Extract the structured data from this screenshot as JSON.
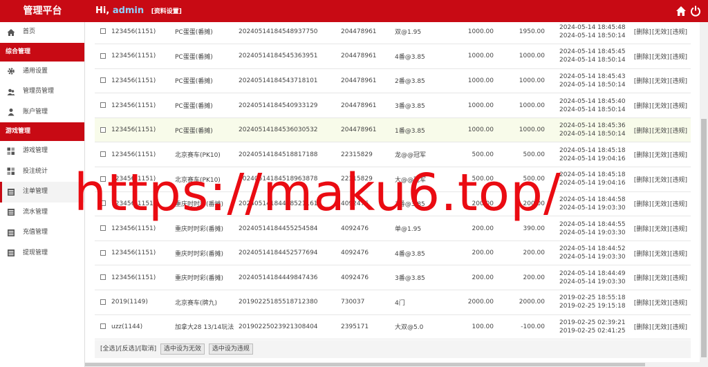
{
  "header": {
    "brand": "管理平台",
    "greeting": "Hi,",
    "username": "admin",
    "profile_link": "[资料设置]",
    "icons": [
      "home-icon",
      "power-icon"
    ]
  },
  "sidebar": {
    "home": "首页",
    "section1": "综合管理",
    "general_settings": "通用设置",
    "admin_mgmt": "管理员管理",
    "account_mgmt": "账户管理",
    "section2": "游戏管理",
    "game_mgmt": "游戏管理",
    "bet_stats": "投注统计",
    "order_mgmt": "注单管理",
    "flow_mgmt": "流水管理",
    "recharge_mgmt": "充值管理",
    "withdraw_mgmt": "提现管理"
  },
  "rows": [
    {
      "user": "123456(1151)",
      "game": "PC蛋蛋(番摊)",
      "order": "20240514184548937750",
      "period": "204478961",
      "bet": "双@1.95",
      "amount": "1000.00",
      "payout": "1950.00",
      "t1": "2024-05-14 18:45:48",
      "t2": "2024-05-14 18:50:14",
      "highlight": false
    },
    {
      "user": "123456(1151)",
      "game": "PC蛋蛋(番摊)",
      "order": "20240514184545363951",
      "period": "204478961",
      "bet": "4番@3.85",
      "amount": "1000.00",
      "payout": "1000.00",
      "t1": "2024-05-14 18:45:45",
      "t2": "2024-05-14 18:50:14",
      "highlight": false
    },
    {
      "user": "123456(1151)",
      "game": "PC蛋蛋(番摊)",
      "order": "20240514184543718101",
      "period": "204478961",
      "bet": "2番@3.85",
      "amount": "1000.00",
      "payout": "1000.00",
      "t1": "2024-05-14 18:45:43",
      "t2": "2024-05-14 18:50:14",
      "highlight": false
    },
    {
      "user": "123456(1151)",
      "game": "PC蛋蛋(番摊)",
      "order": "20240514184540933129",
      "period": "204478961",
      "bet": "3番@3.85",
      "amount": "1000.00",
      "payout": "1000.00",
      "t1": "2024-05-14 18:45:40",
      "t2": "2024-05-14 18:50:14",
      "highlight": false
    },
    {
      "user": "123456(1151)",
      "game": "PC蛋蛋(番摊)",
      "order": "20240514184536030532",
      "period": "204478961",
      "bet": "1番@3.85",
      "amount": "1000.00",
      "payout": "1000.00",
      "t1": "2024-05-14 18:45:36",
      "t2": "2024-05-14 18:50:14",
      "highlight": true
    },
    {
      "user": "123456(1151)",
      "game": "北京赛车(PK10)",
      "order": "20240514184518817188",
      "period": "22315829",
      "bet": "龙@@冠军",
      "amount": "500.00",
      "payout": "500.00",
      "t1": "2024-05-14 18:45:18",
      "t2": "2024-05-14 19:04:16",
      "highlight": false
    },
    {
      "user": "123456(1151)",
      "game": "北京赛车(PK10)",
      "order": "20240514184518963878",
      "period": "22315829",
      "bet": "大@@冠军",
      "amount": "500.00",
      "payout": "500.00",
      "t1": "2024-05-14 18:45:18",
      "t2": "2024-05-14 19:04:16",
      "highlight": false
    },
    {
      "user": "123456(1151)",
      "game": "重庆时时彩(番摊)",
      "order": "20240514184458521161",
      "period": "4092476",
      "bet": "3番@3.85",
      "amount": "200.00",
      "payout": "200.00",
      "t1": "2024-05-14 18:44:58",
      "t2": "2024-05-14 19:03:30",
      "highlight": false
    },
    {
      "user": "123456(1151)",
      "game": "重庆时时彩(番摊)",
      "order": "20240514184455254584",
      "period": "4092476",
      "bet": "单@1.95",
      "amount": "200.00",
      "payout": "390.00",
      "t1": "2024-05-14 18:44:55",
      "t2": "2024-05-14 19:03:30",
      "highlight": false
    },
    {
      "user": "123456(1151)",
      "game": "重庆时时彩(番摊)",
      "order": "20240514184452577694",
      "period": "4092476",
      "bet": "4番@3.85",
      "amount": "200.00",
      "payout": "200.00",
      "t1": "2024-05-14 18:44:52",
      "t2": "2024-05-14 19:03:30",
      "highlight": false
    },
    {
      "user": "123456(1151)",
      "game": "重庆时时彩(番摊)",
      "order": "20240514184449847436",
      "period": "4092476",
      "bet": "3番@3.85",
      "amount": "200.00",
      "payout": "200.00",
      "t1": "2024-05-14 18:44:49",
      "t2": "2024-05-14 19:03:30",
      "highlight": false
    },
    {
      "user": "2019(1149)",
      "game": "北京赛车(牌九)",
      "order": "20190225185518712380",
      "period": "730037",
      "bet": "4门",
      "amount": "2000.00",
      "payout": "2000.00",
      "t1": "2019-02-25 18:55:18",
      "t2": "2019-02-25 19:15:18",
      "highlight": false
    },
    {
      "user": "uzz(1144)",
      "game": "加拿大28 13/14玩法",
      "order": "20190225023921308404",
      "period": "2395171",
      "bet": "大双@5.0",
      "amount": "100.00",
      "payout": "-100.00",
      "t1": "2019-02-25 02:39:21",
      "t2": "2019-02-25 02:41:25",
      "highlight": false
    }
  ],
  "row_ops": {
    "delete": "[删除]",
    "invalid": "[无效]",
    "violation": "[违规]"
  },
  "actions": {
    "select_text": "[全选]/[反选]/[取消]",
    "set_invalid": "选中设为无效",
    "set_violation": "选中设为违规"
  },
  "watermark": "https://maku6.top/"
}
